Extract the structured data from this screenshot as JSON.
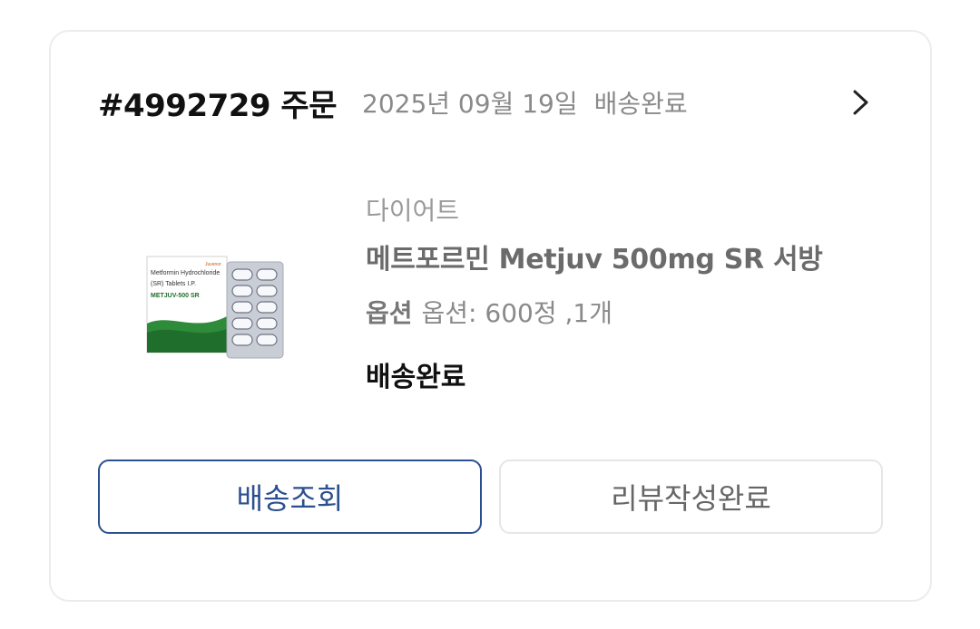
{
  "order": {
    "id_label": "#4992729 주문",
    "date": "2025년 09월 19일",
    "status": "배송완료"
  },
  "item": {
    "category": "다이어트",
    "name": "메트포르민 Metjuv 500mg SR 서방",
    "option_label": "옵션",
    "option_value": "옵션: 600정 ,1개",
    "delivery_status": "배송완료",
    "thumbnail": {
      "box_text_line1": "Metformin Hydrochloride",
      "box_text_line2": "(SR) Tablets I.P.",
      "box_brand": "METJUV-500 SR",
      "box_maker": "Juvenor"
    }
  },
  "buttons": {
    "track": "배송조회",
    "review": "리뷰작성완료"
  },
  "colors": {
    "accent": "#2c4f8f",
    "muted_text": "#8a8a8a",
    "border": "#ececec"
  },
  "icons": {
    "chevron": "chevron-right-icon"
  }
}
